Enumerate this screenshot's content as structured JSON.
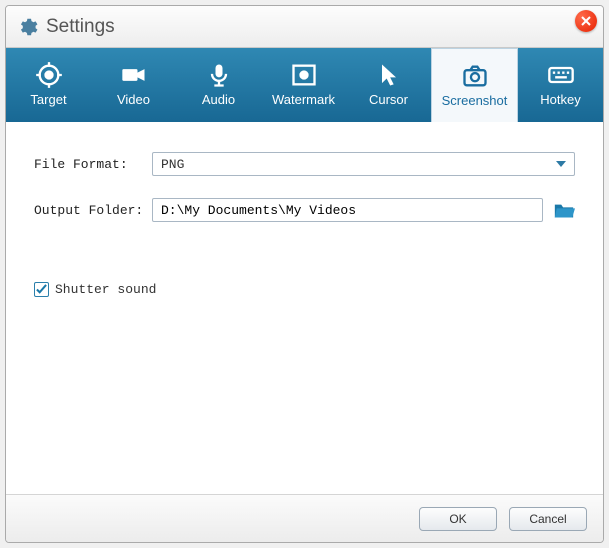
{
  "window": {
    "title": "Settings"
  },
  "tabs": {
    "target": "Target",
    "video": "Video",
    "audio": "Audio",
    "watermark": "Watermark",
    "cursor": "Cursor",
    "screenshot": "Screenshot",
    "hotkey": "Hotkey"
  },
  "form": {
    "file_format_label": "File Format:",
    "file_format_value": "PNG",
    "output_folder_label": "Output Folder:",
    "output_folder_value": "D:\\My Documents\\My Videos",
    "shutter_sound_label": "Shutter sound",
    "shutter_sound_checked": true
  },
  "buttons": {
    "ok": "OK",
    "cancel": "Cancel"
  }
}
